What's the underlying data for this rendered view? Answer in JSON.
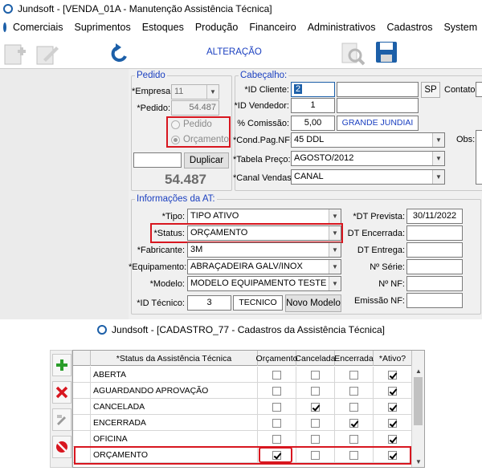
{
  "main_window": {
    "title": "Jundsoft - [VENDA_01A - Manutenção Assistência Técnica]",
    "menu": [
      "Comerciais",
      "Suprimentos",
      "Estoques",
      "Produção",
      "Financeiro",
      "Administrativos",
      "Cadastros",
      "System"
    ],
    "mode_label": "ALTERAÇÃO",
    "pedido_group": {
      "legend": "Pedido",
      "empresa_label": "*Empresa:",
      "empresa_value": "11",
      "pedido_label": "*Pedido:",
      "pedido_value": "54.487",
      "radio_pedido": "Pedido",
      "radio_orcamento": "Orçamento",
      "duplicar_label": "Duplicar",
      "big_number": "54.487"
    },
    "cabecalho_group": {
      "legend": "Cabeçalho:",
      "id_cliente_label": "*ID Cliente:",
      "id_cliente_value": "2",
      "uf_value": "SP",
      "contato_label": "Contato:",
      "id_vendedor_label": "*ID Vendedor:",
      "id_vendedor_value": "1",
      "comissao_label": "% Comissão:",
      "comissao_value": "5,00",
      "cidade_value": "GRANDE JUNDIAI",
      "cond_pag_label": "*Cond.Pag.NF:",
      "cond_pag_value": "45 DDL",
      "obs_label": "Obs:",
      "tabela_label": "*Tabela Preço:",
      "tabela_value": "AGOSTO/2012",
      "canal_label": "*Canal Vendas:",
      "canal_value": "CANAL"
    },
    "info_group": {
      "legend": "Informações da AT:",
      "tipo_label": "*Tipo:",
      "tipo_value": "TIPO ATIVO",
      "status_label": "*Status:",
      "status_value": "ORÇAMENTO",
      "fabricante_label": "*Fabricante:",
      "fabricante_value": "3M",
      "equipamento_label": "*Equipamento:",
      "equipamento_value": "ABRAÇADEIRA GALV/INOX",
      "modelo_label": "*Modelo:",
      "modelo_value": "MODELO EQUIPAMENTO TESTE",
      "id_tecnico_label": "*ID Técnico:",
      "id_tecnico_value": "3",
      "tecnico_value": "TECNICO",
      "novo_modelo_label": "Novo Modelo",
      "dt_prevista_label": "*DT Prevista:",
      "dt_prevista_value": "30/11/2022",
      "dt_encerrada_label": "DT Encerrada:",
      "dt_entrega_label": "DT Entrega:",
      "serie_label": "Nº Série:",
      "nf_label": "Nº NF:",
      "emissao_label": "Emissão NF:"
    }
  },
  "second_window": {
    "title": "Jundsoft - [CADASTRO_77 - Cadastros da Assistência Técnica]",
    "columns": [
      "*Status da Assistência Técnica",
      "Orçamento",
      "Cancelada",
      "Encerrada",
      "*Ativo?"
    ],
    "rows": [
      {
        "name": "ABERTA",
        "orcamento": false,
        "cancelada": false,
        "encerrada": false,
        "ativo": true
      },
      {
        "name": "AGUARDANDO APROVAÇÃO",
        "orcamento": false,
        "cancelada": false,
        "encerrada": false,
        "ativo": true
      },
      {
        "name": "CANCELADA",
        "orcamento": false,
        "cancelada": true,
        "encerrada": false,
        "ativo": true
      },
      {
        "name": "ENCERRADA",
        "orcamento": false,
        "cancelada": false,
        "encerrada": true,
        "ativo": true
      },
      {
        "name": "OFICINA",
        "orcamento": false,
        "cancelada": false,
        "encerrada": false,
        "ativo": true
      },
      {
        "name": "ORÇAMENTO",
        "orcamento": true,
        "cancelada": false,
        "encerrada": false,
        "ativo": true
      }
    ]
  },
  "colors": {
    "accent_blue": "#1a3fc0",
    "highlight_red": "#d8161f"
  }
}
